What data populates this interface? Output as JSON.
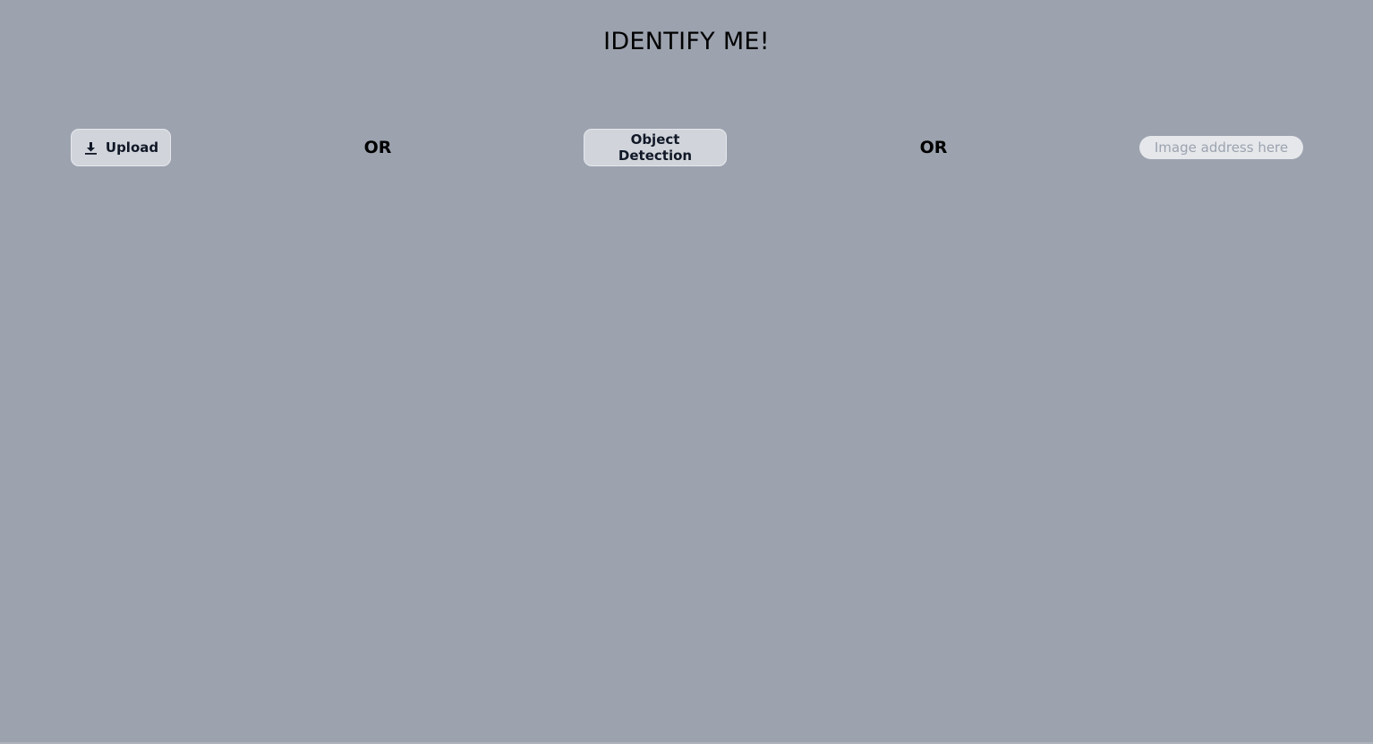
{
  "page": {
    "title": "IDENTIFY ME!"
  },
  "controls": {
    "upload_label": "Upload",
    "upload_icon": "download-icon",
    "or_text_1": "OR",
    "detect_label": "Object Detection",
    "or_text_2": "OR",
    "url_input": {
      "value": "",
      "placeholder": "Image address here"
    }
  },
  "colors": {
    "background": "#9ca3af",
    "button_bg": "#d1d5db",
    "input_bg": "#e5e7eb"
  }
}
